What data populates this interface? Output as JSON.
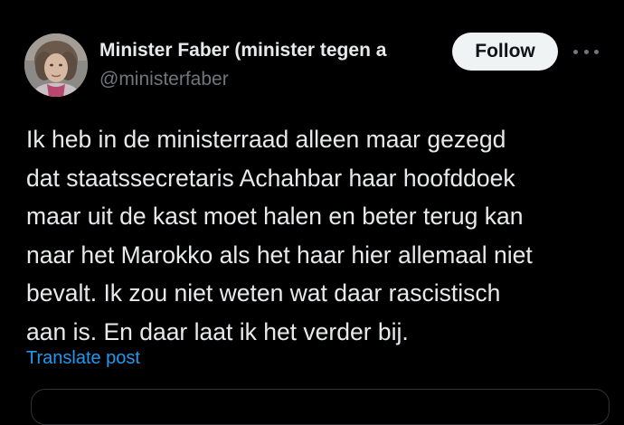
{
  "author": {
    "display_name": "Minister Faber (minister tegen a",
    "handle": "@ministerfaber",
    "avatar_icon": "profile-photo"
  },
  "actions": {
    "follow_label": "Follow",
    "more_icon": "more-horizontal-icon"
  },
  "tweet": {
    "lines": [
      "Ik heb in de ministerraad alleen maar gezegd",
      "dat staatssecretaris Achahbar haar hoofddoek",
      "maar uit de kast moet halen en beter terug kan",
      "naar het Marokko als het haar hier allemaal niet",
      "bevalt. Ik zou niet weten wat daar rascistisch",
      "aan is. En daar laat ik het verder bij."
    ],
    "translate_label": "Translate post"
  },
  "colors": {
    "background": "#000000",
    "text_primary": "#e7e9ea",
    "text_secondary": "#71767b",
    "link": "#1d9bf0",
    "button_bg": "#eff3f4",
    "button_text": "#0f1419"
  }
}
